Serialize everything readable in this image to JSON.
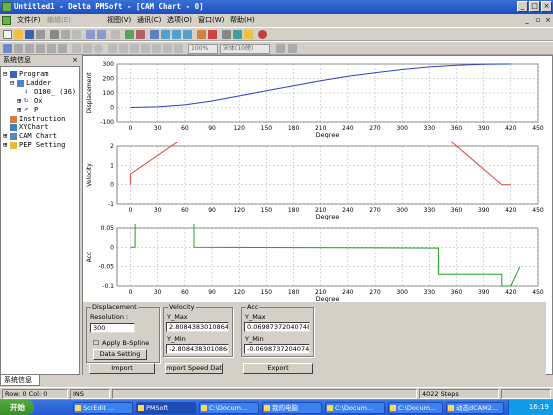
{
  "window": {
    "title": "Untitled1 - Delta PMSoft - [CAM Chart - 0]"
  },
  "menu": [
    "文件(F)",
    "编辑(E)",
    "视图(V)",
    "通讯(C)",
    "选项(O)",
    "窗口(W)",
    "帮助(H)"
  ],
  "toolbar": {
    "zoom": "100%",
    "font": "宋体(10磅)"
  },
  "panel": {
    "title": "系统信息",
    "tab": "系统信息"
  },
  "tree": {
    "program": "Program",
    "ladder": "Ladder",
    "ladder_item": "O100_ (36)",
    "ox": "Ox",
    "p": "P",
    "instruction": "Instruction",
    "xychart": "XYChart",
    "camchart": "CAM Chart",
    "pep": "PEP Setting"
  },
  "chart_data": [
    {
      "type": "line",
      "xlabel": "Degree",
      "ylabel": "Displacement",
      "xlim": [
        -15,
        450
      ],
      "ylim": [
        -100,
        300
      ],
      "yticks": [
        -100,
        0,
        100,
        200,
        300
      ],
      "xticks": [
        0,
        30,
        60,
        90,
        120,
        150,
        180,
        210,
        240,
        270,
        300,
        330,
        360,
        390,
        420,
        450
      ],
      "x": [
        0,
        30,
        60,
        90,
        120,
        150,
        180,
        210,
        240,
        270,
        300,
        330,
        360,
        390,
        420
      ],
      "y": [
        0,
        4,
        18,
        45,
        80,
        115,
        150,
        185,
        215,
        240,
        262,
        280,
        292,
        298,
        300
      ],
      "color": "#3040c8"
    },
    {
      "type": "line",
      "xlabel": "Degree",
      "ylabel": "Velocity",
      "xlim": [
        -15,
        450
      ],
      "ylim": [
        -1,
        2
      ],
      "yticks": [
        -1,
        0,
        1,
        2
      ],
      "xticks": [
        0,
        30,
        60,
        90,
        120,
        150,
        180,
        210,
        240,
        270,
        300,
        330,
        360,
        390,
        420,
        450
      ],
      "x": [
        0,
        0,
        70,
        340,
        410,
        420
      ],
      "y": [
        0,
        0.55,
        2.808,
        2.808,
        0,
        0
      ],
      "color": "#e04040"
    },
    {
      "type": "line",
      "xlabel": "Degree",
      "ylabel": "Acc",
      "xlim": [
        -15,
        450
      ],
      "ylim": [
        -0.1,
        0.05
      ],
      "yticks": [
        -0.1,
        -0.05,
        0,
        0.05
      ],
      "xticks": [
        0,
        30,
        60,
        90,
        120,
        150,
        180,
        210,
        240,
        270,
        300,
        330,
        360,
        390,
        420,
        450
      ],
      "x": [
        0,
        5,
        5,
        70,
        70,
        340,
        340,
        410,
        410,
        420,
        430
      ],
      "y": [
        0,
        0,
        0.0698,
        0.0698,
        0,
        -0.002,
        -0.0698,
        -0.0698,
        -0.1,
        -0.1,
        -0.05
      ],
      "color": "#20a020"
    }
  ],
  "form": {
    "disp_title": "Displacement",
    "resolution_label": "Resolution :",
    "resolution": "300",
    "bspline": "Apply B-Spline",
    "data_setting": "Data Setting",
    "vel_title": "Velocity",
    "vel_ymax_label": "Y_Max",
    "vel_ymax": "2.80843830108643",
    "vel_ymin_label": "Y_Min",
    "vel_ymin": "-2.80843830108643",
    "acc_title": "Acc",
    "acc_ymax_label": "Y_Max",
    "acc_ymax": "0.0698737204074​86",
    "acc_ymin_label": "Y_Min",
    "acc_ymin": "-0.069873720407486",
    "import": "Import",
    "import_speed": "mport Speed Dat",
    "export": "Export"
  },
  "status": {
    "rowcol": "Row: 0  Col: 0",
    "ins": "INS",
    "steps": "4022 Steps"
  },
  "taskbar": {
    "start": "开始",
    "tasks": [
      "ScrEdit ...",
      "PMSoft",
      "C:\\Docum...",
      "我的电脑",
      "C:\\Docum...",
      "C:\\Docum...",
      "动态dCAM2..."
    ],
    "time": "16:19"
  }
}
